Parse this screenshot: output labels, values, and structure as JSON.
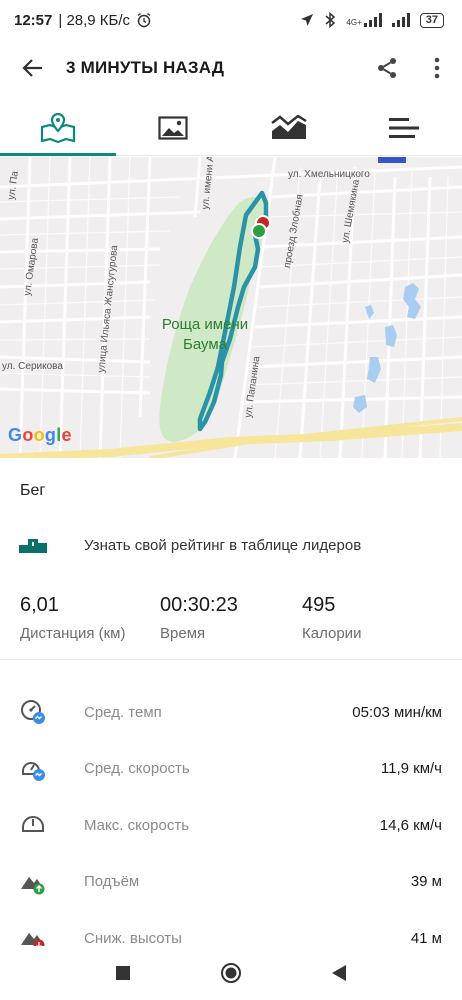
{
  "status": {
    "time": "12:57",
    "speed": "| 28,9 КБ/с",
    "network": "4G+",
    "battery": "37"
  },
  "header": {
    "title": "3 МИНУТЫ НАЗАД"
  },
  "tabs": [
    {
      "icon": "map-icon",
      "active": true
    },
    {
      "icon": "photo-icon",
      "active": false
    },
    {
      "icon": "chart-icon",
      "active": false
    },
    {
      "icon": "list-icon",
      "active": false
    }
  ],
  "map": {
    "park_label": "Роща имени Баума",
    "streets": [
      "ул. Хмельницкого",
      "ул. Шемякина",
      "ул. Папанина",
      "ул. Серикова",
      "ул. Омарова",
      "улица Ильяса Жансугурова",
      "ул. имени Акан",
      "проезд Злобная",
      "ул. Па"
    ],
    "google": [
      "G",
      "o",
      "o",
      "g",
      "l",
      "e"
    ]
  },
  "activity": {
    "type": "Бег",
    "leaderboard_text": "Узнать свой рейтинг в таблице лидеров"
  },
  "summary": [
    {
      "value": "6,01",
      "label": "Дистанция (км)"
    },
    {
      "value": "00:30:23",
      "label": "Время"
    },
    {
      "value": "495",
      "label": "Калории"
    }
  ],
  "details": [
    {
      "icon": "avg-pace-icon",
      "label": "Сред. темп",
      "value": "05:03 мин/км"
    },
    {
      "icon": "avg-speed-icon",
      "label": "Сред. скорость",
      "value": "11,9 км/ч"
    },
    {
      "icon": "max-speed-icon",
      "label": "Макс. скорость",
      "value": "14,6 км/ч"
    },
    {
      "icon": "elevation-gain-icon",
      "label": "Подъём",
      "value": "39 м"
    },
    {
      "icon": "elevation-loss-icon",
      "label": "Сниж. высоты",
      "value": "41 м"
    }
  ],
  "colors": {
    "accent": "#0b8a82",
    "route": "#2a93a8",
    "park": "#cfe8c6",
    "road_yellow": "#f6e59b"
  }
}
